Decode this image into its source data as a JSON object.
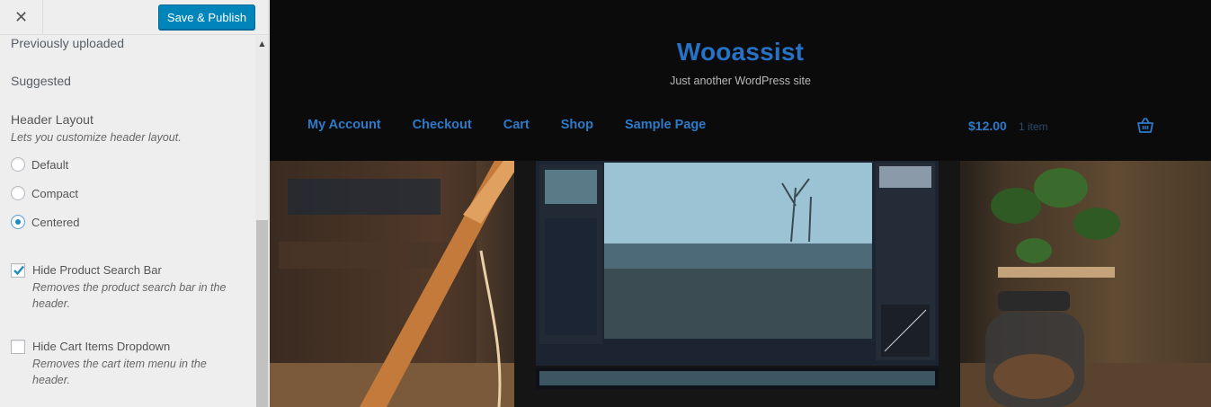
{
  "toolbar": {
    "close_symbol": "✕",
    "publish_label": "Save & Publish"
  },
  "sidebar": {
    "section_previously_uploaded": "Previously uploaded",
    "section_suggested": "Suggested",
    "header_layout": {
      "title": "Header Layout",
      "description": "Lets you customize header layout.",
      "options": [
        {
          "label": "Default",
          "checked": false
        },
        {
          "label": "Compact",
          "checked": false
        },
        {
          "label": "Centered",
          "checked": true
        }
      ]
    },
    "checkboxes": [
      {
        "label": "Hide Product Search Bar",
        "description": "Removes the product search bar in the header.",
        "checked": true
      },
      {
        "label": "Hide Cart Items Dropdown",
        "description": "Removes the cart item menu in the header.",
        "checked": false
      }
    ]
  },
  "site": {
    "title": "Wooassist",
    "tagline": "Just another WordPress site",
    "nav": [
      "My Account",
      "Checkout",
      "Cart",
      "Shop",
      "Sample Page"
    ],
    "cart_amount": "$12.00",
    "cart_count": "1 item"
  },
  "colors": {
    "publish_bg": "#0085ba",
    "link": "#2e7ac9",
    "site_bg": "#0b0b0b"
  }
}
